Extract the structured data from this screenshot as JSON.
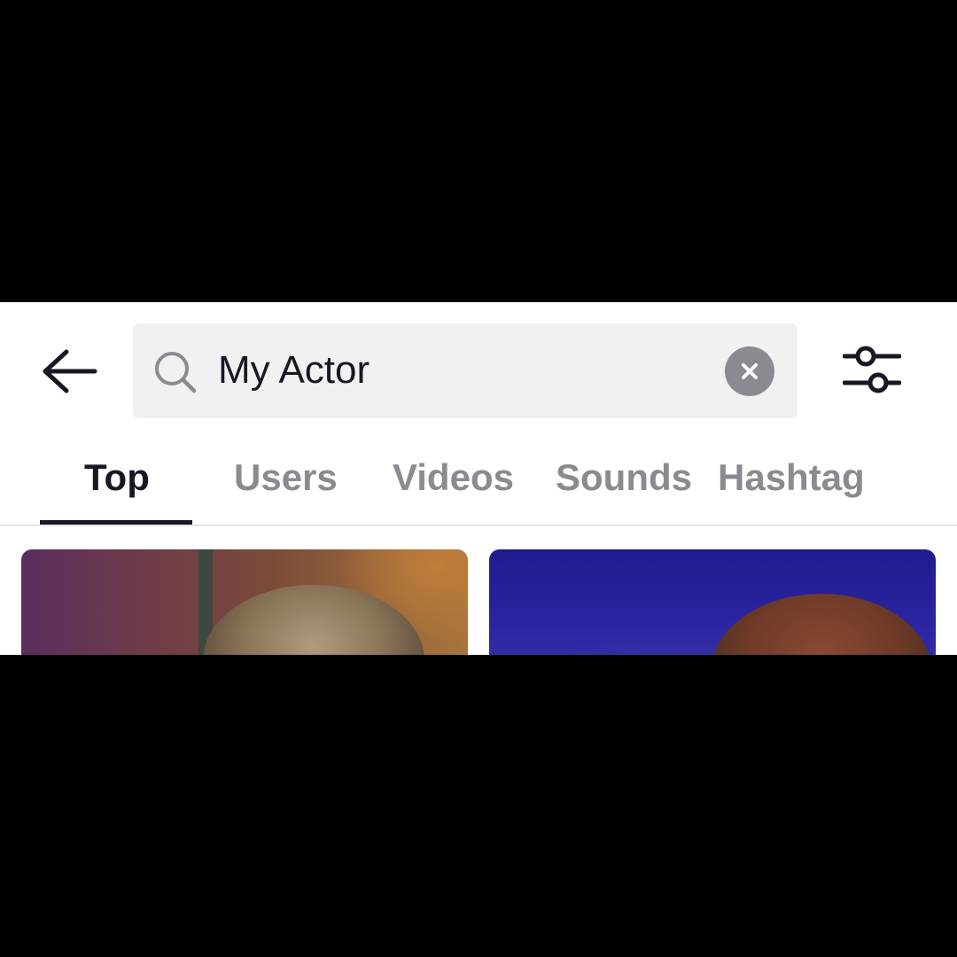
{
  "search": {
    "value": "My Actor",
    "back_icon": "arrow-left-icon",
    "search_icon": "search-icon",
    "clear_icon": "close-circle-icon",
    "filter_icon": "sliders-icon"
  },
  "tabs": [
    {
      "label": "Top",
      "active": true
    },
    {
      "label": "Users",
      "active": false
    },
    {
      "label": "Videos",
      "active": false
    },
    {
      "label": "Sounds",
      "active": false
    },
    {
      "label": "Hashtag",
      "active": false
    }
  ],
  "colors": {
    "active_tab": "#161823",
    "inactive_tab": "#8a8b91",
    "search_bg": "#f1f1f2",
    "clear_button": "#8a8b91"
  }
}
